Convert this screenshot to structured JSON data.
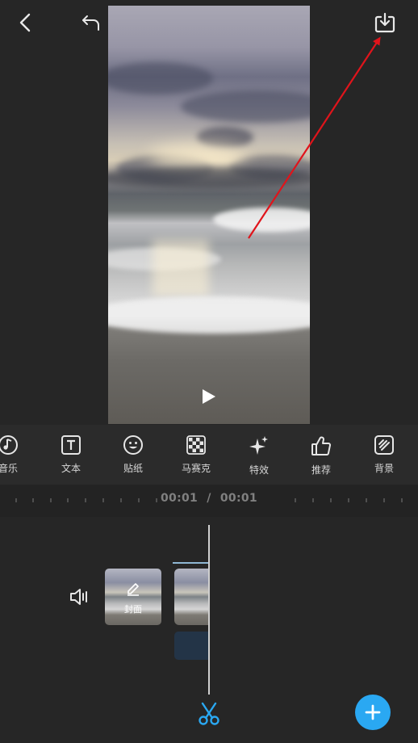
{
  "toolbar": {
    "tools": [
      {
        "label": "音乐",
        "icon": "music-icon"
      },
      {
        "label": "文本",
        "icon": "text-icon"
      },
      {
        "label": "贴纸",
        "icon": "sticker-icon"
      },
      {
        "label": "马赛克",
        "icon": "mosaic-icon"
      },
      {
        "label": "特效",
        "icon": "effects-sparkle-icon"
      },
      {
        "label": "推荐",
        "icon": "thumbs-up-icon"
      },
      {
        "label": "背景",
        "icon": "background-icon"
      }
    ]
  },
  "timeline": {
    "current_time": "00:01",
    "separator": "/",
    "total_time": "00:01",
    "cover_label": "封面"
  },
  "colors": {
    "accent": "#2aa8f2",
    "annotation_arrow": "#e0141b",
    "background": "#262626"
  }
}
